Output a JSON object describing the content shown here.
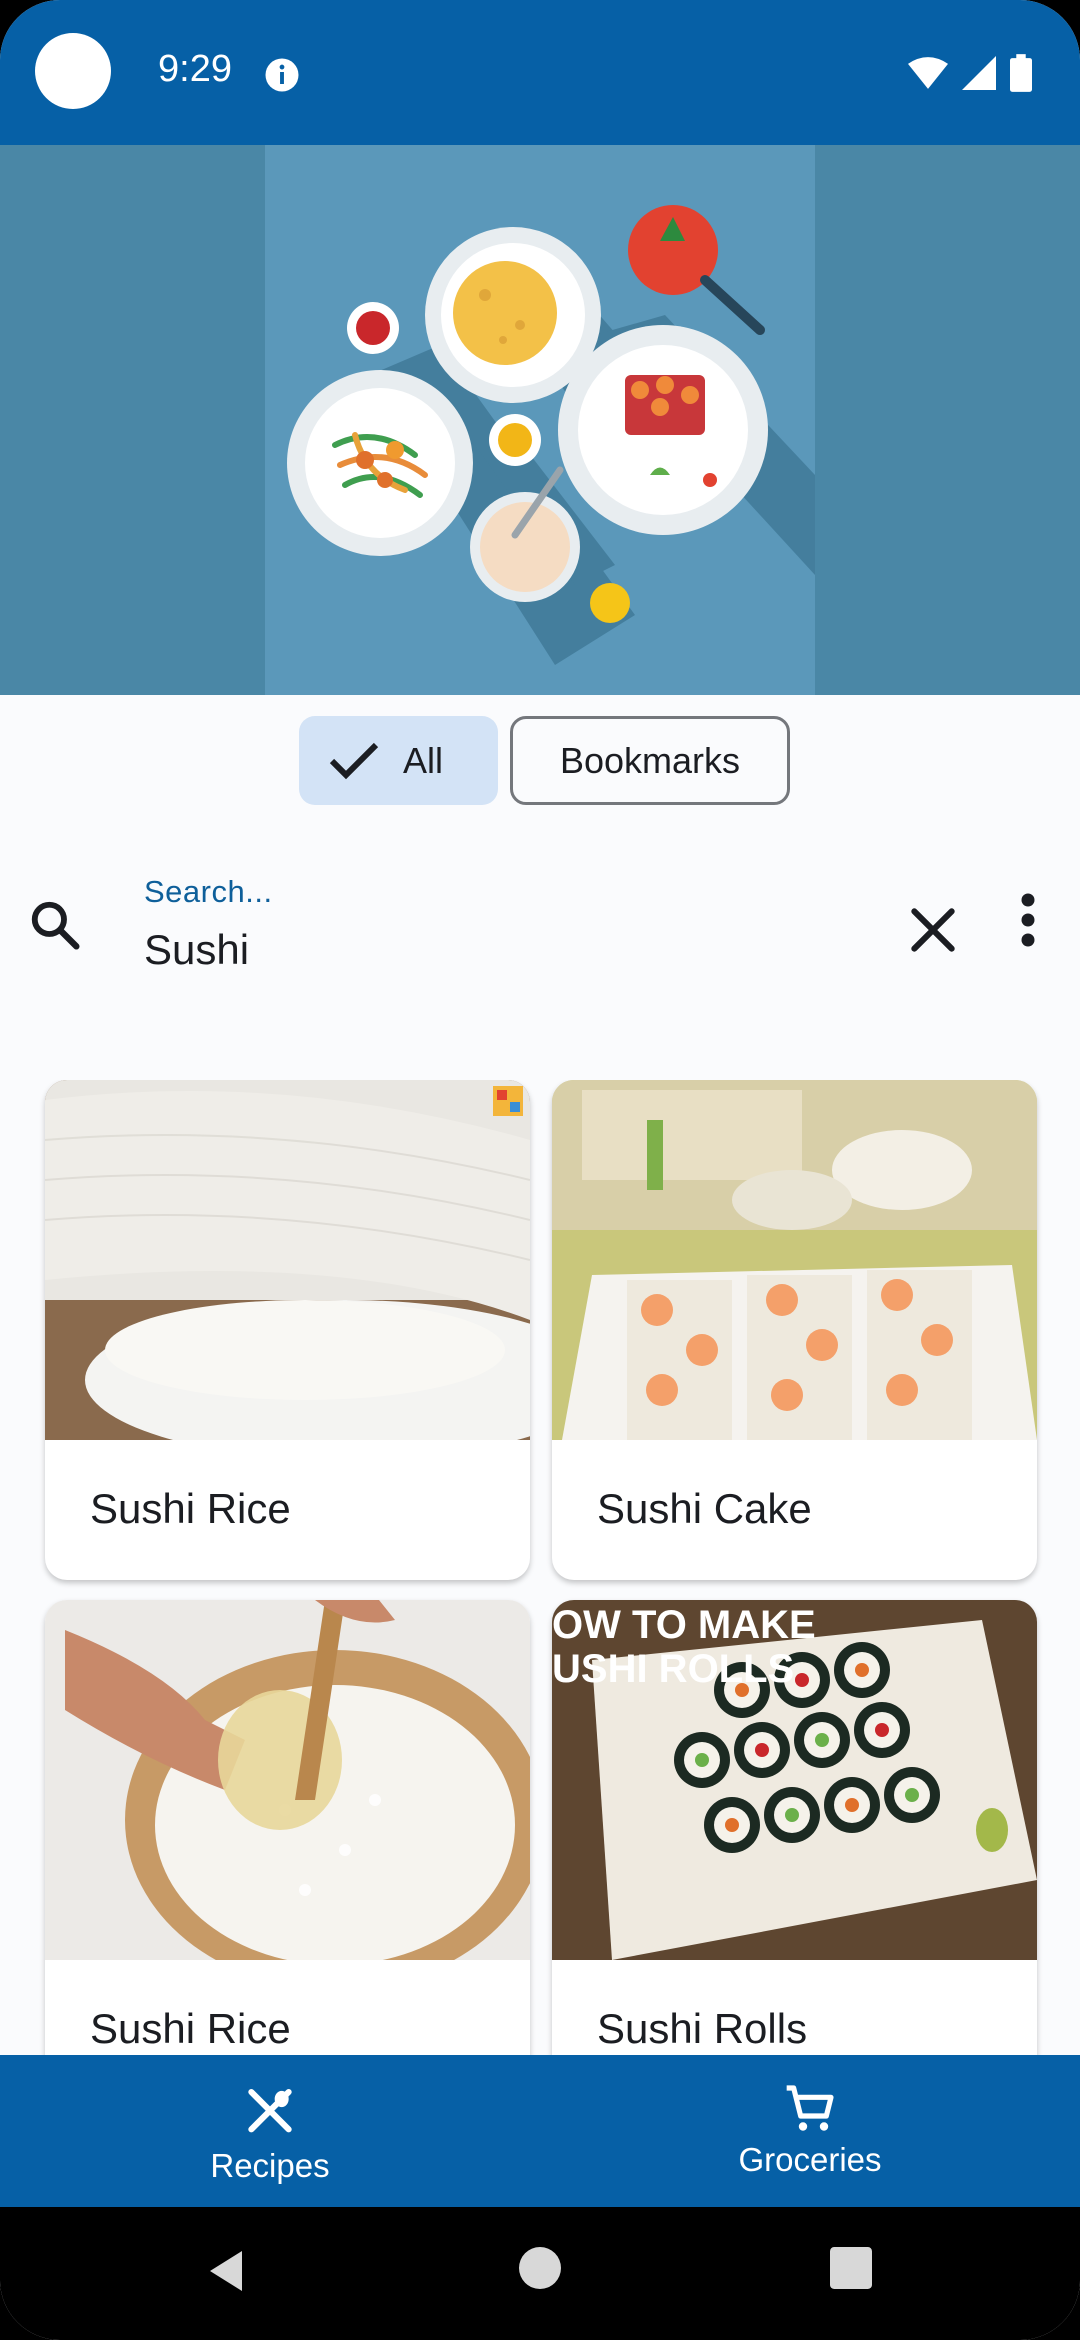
{
  "status_bar": {
    "time": "9:29"
  },
  "filters": [
    {
      "label": "All",
      "selected": true
    },
    {
      "label": "Bookmarks",
      "selected": false
    }
  ],
  "search": {
    "label": "Search...",
    "value": "Sushi"
  },
  "recipes": [
    {
      "title": "Sushi Rice"
    },
    {
      "title": "Sushi Cake"
    },
    {
      "title": "Sushi Rice"
    },
    {
      "title": "Sushi Rolls"
    }
  ],
  "card_overlay_text": "OW TO MAKE USHI ROLLS",
  "bottom_nav": [
    {
      "label": "Recipes",
      "icon": "utensils-icon"
    },
    {
      "label": "Groceries",
      "icon": "cart-icon"
    }
  ],
  "colors": {
    "primary": "#0660a6",
    "chip_selected": "#d3e3f6",
    "accent_text": "#0e5f9a"
  }
}
